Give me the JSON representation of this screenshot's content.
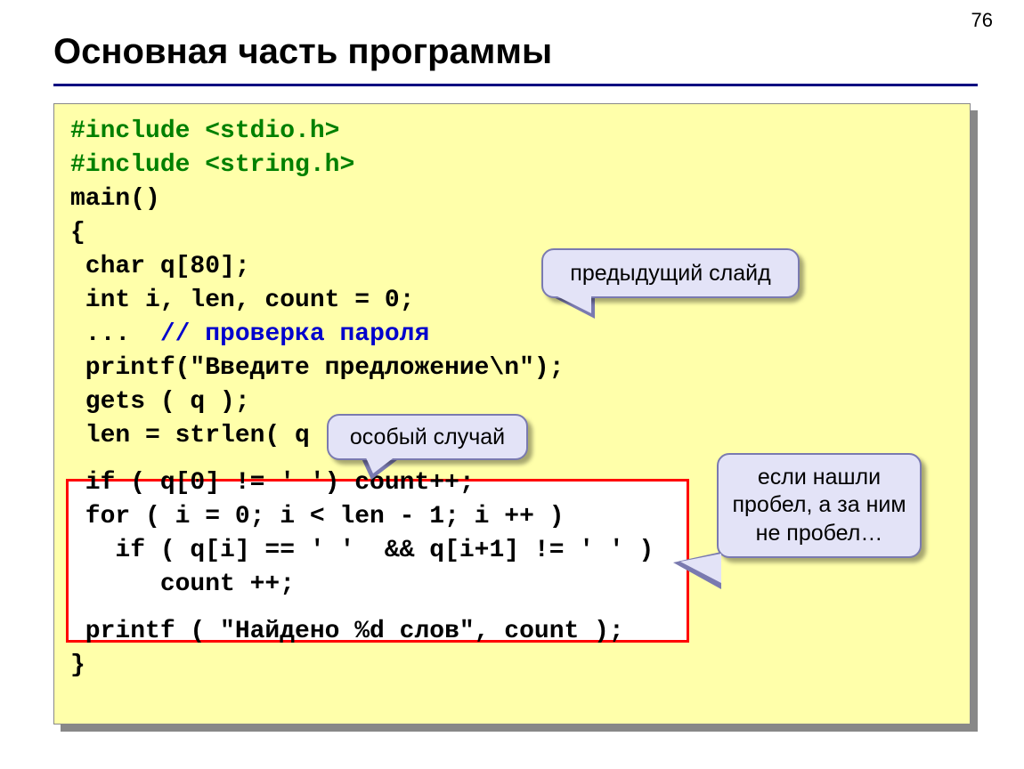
{
  "page_number": "76",
  "title": "Основная часть программы",
  "code": {
    "l1a": "#include ",
    "l1b": "<stdio.h>",
    "l2a": "#include ",
    "l2b": "<string.h>",
    "l3": "main()",
    "l4": "{",
    "l5": " char q[80];",
    "l6": " int i, len, count = 0;",
    "l7a": " ...  ",
    "l7b": "// проверка пароля",
    "l8": " printf(\"Введите предложение\\n\");",
    "l9": " gets ( q );",
    "l10": " len = strlen( q );",
    "l11": " if ( q[0] != ' ') count++;",
    "l12": " for ( i = 0; i < len - 1; i ++ )",
    "l13": "   if ( q[i] == ' '  && q[i+1] != ' ' )",
    "l14": "      count ++;",
    "l15": " printf ( \"Найдено %d слов\", count );",
    "l16": "}"
  },
  "callouts": {
    "c1": "предыдущий слайд",
    "c2": "особый случай",
    "c3": "если нашли пробел, а за ним не пробел…"
  }
}
